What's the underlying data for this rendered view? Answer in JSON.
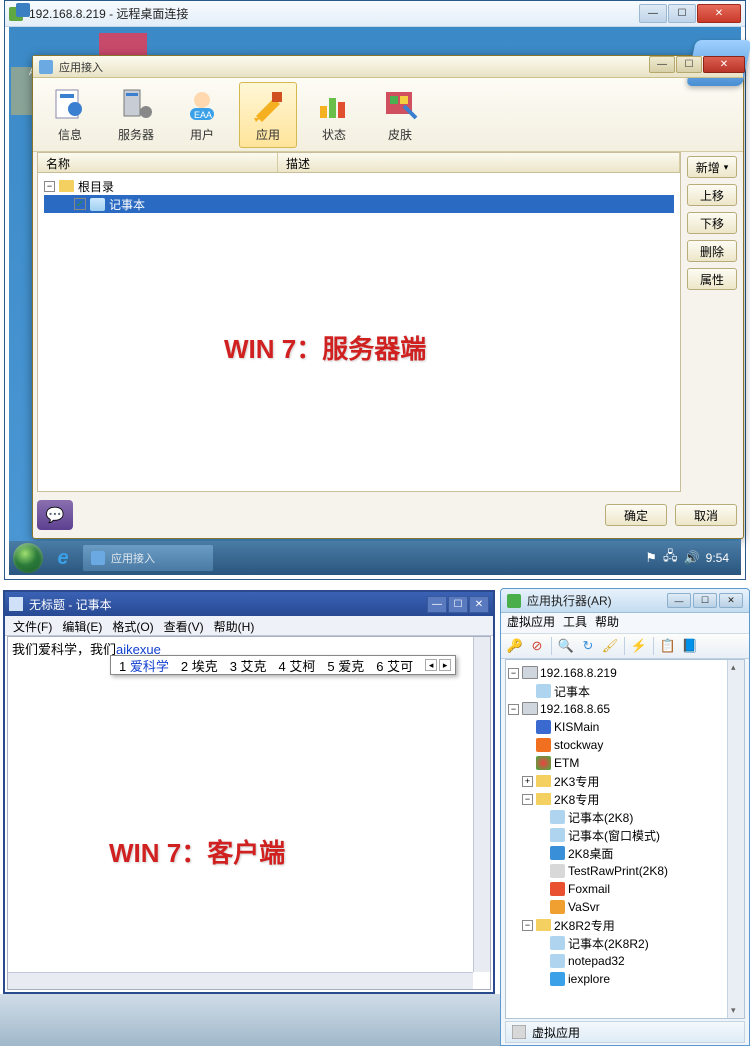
{
  "rdp": {
    "title": "192.168.8.219 - 远程桌面连接",
    "app": {
      "title": "应用接入",
      "toolbar": [
        {
          "label": "信息"
        },
        {
          "label": "服务器"
        },
        {
          "label": "用户"
        },
        {
          "label": "应用"
        },
        {
          "label": "状态"
        },
        {
          "label": "皮肤"
        }
      ],
      "columns": {
        "name": "名称",
        "desc": "描述"
      },
      "root": "根目录",
      "item1": "记事本",
      "side_add": "新增",
      "side_up": "上移",
      "side_down": "下移",
      "side_del": "删除",
      "side_prop": "属性",
      "ok": "确定",
      "cancel": "取消"
    },
    "watermark": "WIN 7：服务器端",
    "taskbar_item": "应用接入",
    "clock": "9:54"
  },
  "notepad": {
    "title": "无标题 - 记事本",
    "menus": [
      "文件(F)",
      "编辑(E)",
      "格式(O)",
      "查看(V)",
      "帮助(H)"
    ],
    "typed_prefix": "我们爱科学，我们",
    "typed_ime": "aikexue",
    "candidates": [
      "1 爱科学",
      "2 埃克",
      "3 艾克",
      "4 艾柯",
      "5 爱克",
      "6 艾可"
    ]
  },
  "watermark2": "WIN 7：客户端",
  "ar": {
    "title": "应用执行器(AR)",
    "menus": [
      "虚拟应用",
      "工具",
      "帮助"
    ],
    "servers": {
      "s1": "192.168.8.219",
      "s1_items": [
        "记事本"
      ],
      "s2": "192.168.8.65",
      "s2_apps": [
        "KISMain",
        "stockway",
        "ETM"
      ],
      "folders": {
        "f1": "2K3专用",
        "f2": "2K8专用",
        "f2_items": [
          "记事本(2K8)",
          "记事本(窗口模式)",
          "2K8桌面",
          "TestRawPrint(2K8)",
          "Foxmail",
          "VaSvr"
        ],
        "f3": "2K8R2专用",
        "f3_items": [
          "记事本(2K8R2)",
          "notepad32",
          "iexplore"
        ]
      }
    },
    "status": "虚拟应用"
  }
}
